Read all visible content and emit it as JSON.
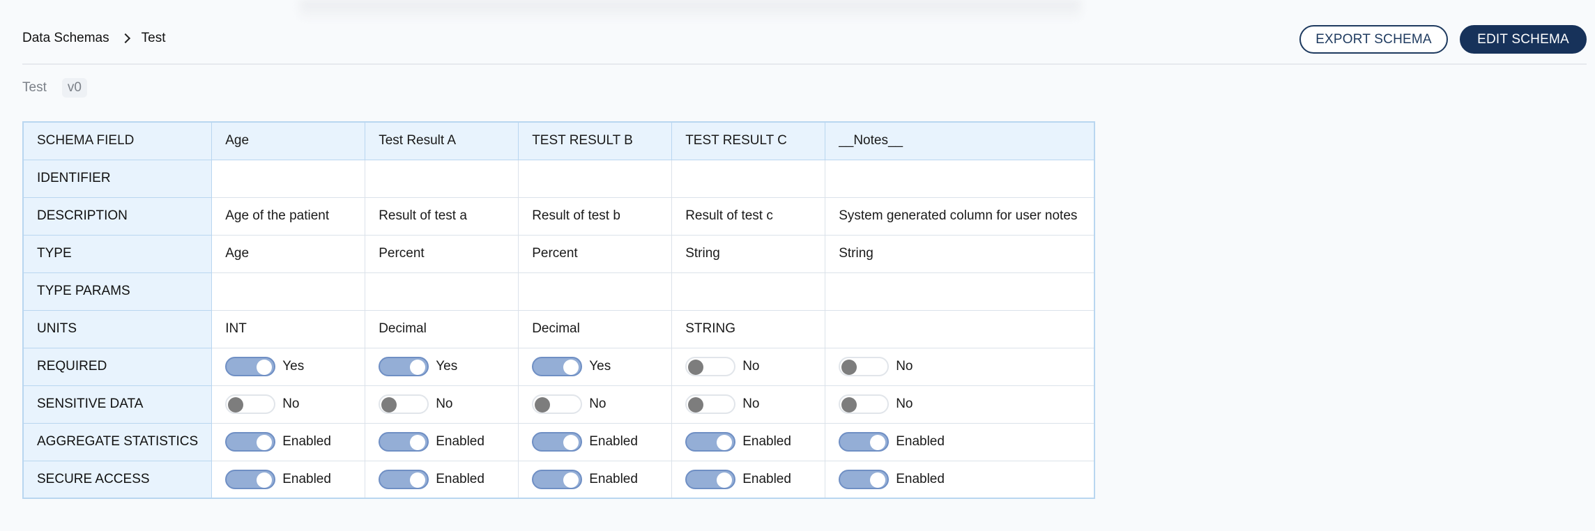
{
  "breadcrumb": {
    "root": "Data Schemas",
    "current": "Test"
  },
  "actions": {
    "export_label": "EXPORT SCHEMA",
    "edit_label": "EDIT SCHEMA"
  },
  "schema": {
    "name": "Test",
    "version": "v0"
  },
  "table": {
    "header": [
      "SCHEMA FIELD",
      "Age",
      "Test Result A",
      "TEST RESULT B",
      "TEST RESULT C",
      "__Notes__"
    ],
    "identifier": {
      "label": "IDENTIFIER",
      "values": [
        "",
        "",
        "",
        "",
        ""
      ]
    },
    "description": {
      "label": "DESCRIPTION",
      "values": [
        "Age of the patient",
        "Result of test a",
        "Result of test b",
        "Result of test c",
        "System generated column for user notes"
      ]
    },
    "type": {
      "label": "TYPE",
      "values": [
        "Age",
        "Percent",
        "Percent",
        "String",
        "String"
      ]
    },
    "type_params": {
      "label": "TYPE PARAMS",
      "values": [
        "",
        "",
        "",
        "",
        ""
      ]
    },
    "units": {
      "label": "UNITS",
      "values": [
        "INT",
        "Decimal",
        "Decimal",
        "STRING",
        ""
      ]
    },
    "required": {
      "label": "REQUIRED",
      "states": [
        true,
        true,
        true,
        false,
        false
      ],
      "texts": [
        "Yes",
        "Yes",
        "Yes",
        "No",
        "No"
      ]
    },
    "sensitive": {
      "label": "SENSITIVE DATA",
      "states": [
        false,
        false,
        false,
        false,
        false
      ],
      "texts": [
        "No",
        "No",
        "No",
        "No",
        "No"
      ]
    },
    "aggregate": {
      "label": "AGGREGATE STATISTICS",
      "states": [
        true,
        true,
        true,
        true,
        true
      ],
      "texts": [
        "Enabled",
        "Enabled",
        "Enabled",
        "Enabled",
        "Enabled"
      ]
    },
    "secure": {
      "label": "SECURE ACCESS",
      "states": [
        true,
        true,
        true,
        true,
        true
      ],
      "texts": [
        "Enabled",
        "Enabled",
        "Enabled",
        "Enabled",
        "Enabled"
      ]
    }
  },
  "colors": {
    "accent": "#17325a",
    "toggle_on": "#94aed6",
    "header_bg": "#e8f3fd"
  }
}
